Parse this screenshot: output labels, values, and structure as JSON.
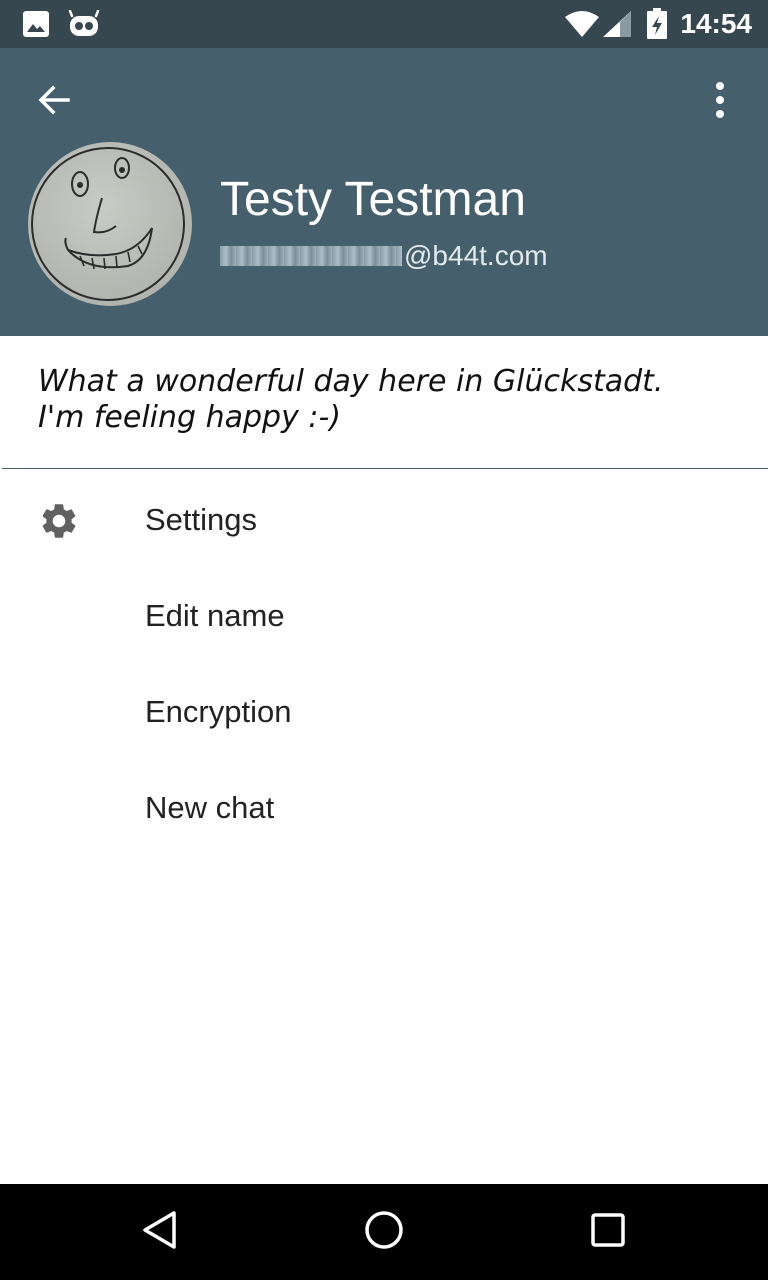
{
  "status_bar": {
    "time": "14:54",
    "icons": [
      "image-icon",
      "cyanogen-icon",
      "wifi-icon",
      "signal-icon",
      "battery-charging-icon"
    ]
  },
  "header": {
    "back_icon": "arrow-left-icon",
    "overflow_icon": "more-vert-icon",
    "name": "Testy Testman",
    "email_domain": "@b44t.com",
    "background_color": "#455f6d",
    "status_bar_color": "#37474f"
  },
  "status_message": {
    "line1": "What a wonderful day here in Glückstadt.",
    "line2": "I'm feeling happy :-)"
  },
  "menu": {
    "items": [
      {
        "label": "Settings",
        "icon": "gear-icon"
      },
      {
        "label": "Edit name"
      },
      {
        "label": "Encryption"
      },
      {
        "label": "New chat"
      }
    ]
  },
  "nav_bar": {
    "icons": [
      "back-triangle-icon",
      "home-circle-icon",
      "recents-square-icon"
    ]
  }
}
